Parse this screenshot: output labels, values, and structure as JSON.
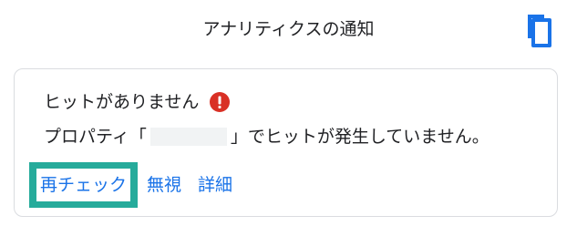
{
  "header": {
    "title": "アナリティクスの通知",
    "copy_icon": "copy-icon"
  },
  "card": {
    "title": "ヒットがありません",
    "status_icon": "error-icon",
    "status_color": "#d93025",
    "message_prefix": "プロパティ「",
    "message_suffix": "」でヒットが発生していません。",
    "actions": {
      "recheck": "再チェック",
      "ignore": "無視",
      "details": "詳細"
    }
  },
  "colors": {
    "link": "#1a73e8",
    "highlight": "#26ab9b",
    "text": "#202124",
    "border": "#dadce0"
  }
}
